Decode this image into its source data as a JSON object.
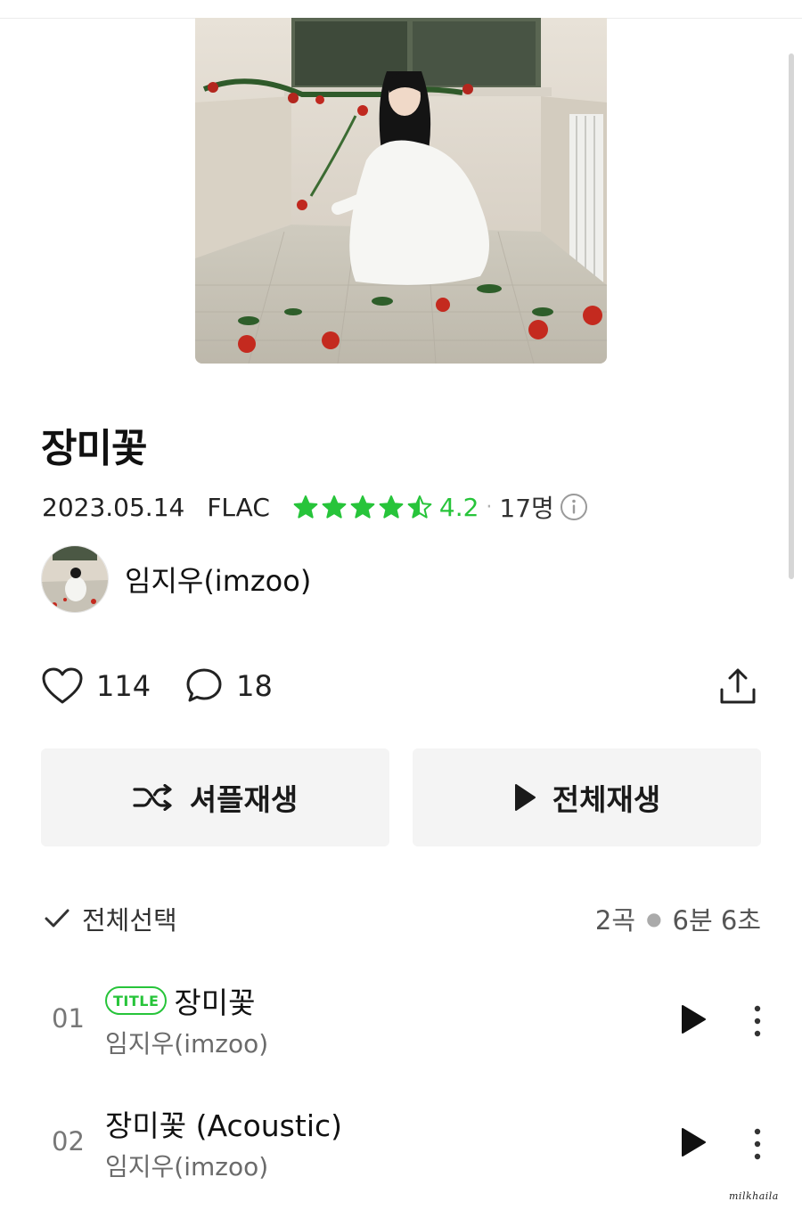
{
  "album": {
    "title": "장미꽃",
    "date": "2023.05.14",
    "format": "FLAC",
    "rating": "4.2",
    "rating_value": 4.2,
    "rating_count": "17명",
    "artist": "임지우(imzoo)"
  },
  "stats": {
    "likes": "114",
    "comments": "18"
  },
  "buttons": {
    "shuffle": "셔플재생",
    "play_all": "전체재생"
  },
  "list": {
    "select_all": "전체선택",
    "track_count": "2곡",
    "duration": "6분 6초"
  },
  "tracks": [
    {
      "no": "01",
      "badge": "TITLE",
      "title": "장미꽃",
      "artist": "임지우(imzoo)"
    },
    {
      "no": "02",
      "title": "장미꽃 (Acoustic)",
      "artist": "임지우(imzoo)"
    }
  ],
  "watermark": "milkhaila",
  "colors": {
    "accent": "#27c43a",
    "button_bg": "#f4f4f4",
    "text": "#111111"
  },
  "icons": [
    "heart-icon",
    "comment-icon",
    "share-icon",
    "shuffle-icon",
    "play-icon",
    "check-icon",
    "more-icon",
    "info-icon",
    "star-icon"
  ]
}
